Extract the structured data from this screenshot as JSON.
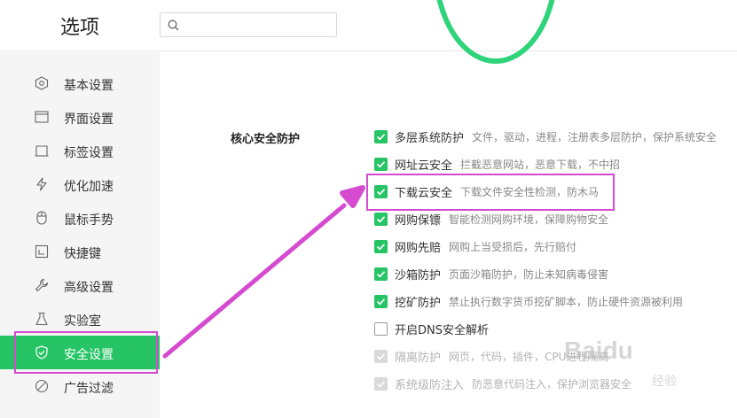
{
  "header": {
    "title": "选项",
    "search_placeholder": ""
  },
  "sidebar": {
    "items": [
      {
        "label": "基本设置",
        "icon": "hexagon-icon"
      },
      {
        "label": "界面设置",
        "icon": "window-icon"
      },
      {
        "label": "标签设置",
        "icon": "tab-icon"
      },
      {
        "label": "优化加速",
        "icon": "lightning-icon"
      },
      {
        "label": "鼠标手势",
        "icon": "mouse-icon"
      },
      {
        "label": "快捷键",
        "icon": "keyboard-icon"
      },
      {
        "label": "高级设置",
        "icon": "wrench-icon"
      },
      {
        "label": "实验室",
        "icon": "flask-icon"
      },
      {
        "label": "安全设置",
        "icon": "shield-icon",
        "active": true
      },
      {
        "label": "广告过滤",
        "icon": "block-icon"
      }
    ]
  },
  "main": {
    "section_label": "核心安全防护",
    "options": [
      {
        "label": "多层系统防护",
        "desc": "文件，驱动，进程，注册表多层防护，保护系统安全",
        "state": "checked"
      },
      {
        "label": "网址云安全",
        "desc": "拦截恶意网站，恶意下载，不中招",
        "state": "checked"
      },
      {
        "label": "下载云安全",
        "desc": "下载文件安全性检测，防木马",
        "state": "checked"
      },
      {
        "label": "网购保镖",
        "desc": "智能检测网购环境，保障购物安全",
        "state": "checked"
      },
      {
        "label": "网购先赔",
        "desc": "网购上当受损后，先行赔付",
        "state": "checked"
      },
      {
        "label": "沙箱防护",
        "desc": "页面沙箱防护，防止未知病毒侵害",
        "state": "checked"
      },
      {
        "label": "挖矿防护",
        "desc": "禁止执行数字货币挖矿脚本，防止硬件资源被利用",
        "state": "checked"
      },
      {
        "label": "开启DNS安全解析",
        "desc": "",
        "state": "unchecked"
      },
      {
        "label": "隔离防护",
        "desc": "网页，代码，插件，CPU进程隔离",
        "state": "disabled"
      },
      {
        "label": "系统级防注入",
        "desc": "防恶意代码注入，保护浏览器安全",
        "state": "disabled"
      }
    ]
  },
  "watermark": {
    "text": "Baidu",
    "sub": "经验"
  },
  "colors": {
    "accent": "#26c465",
    "highlight": "#d54bd0",
    "ring": "#2fd47a"
  }
}
